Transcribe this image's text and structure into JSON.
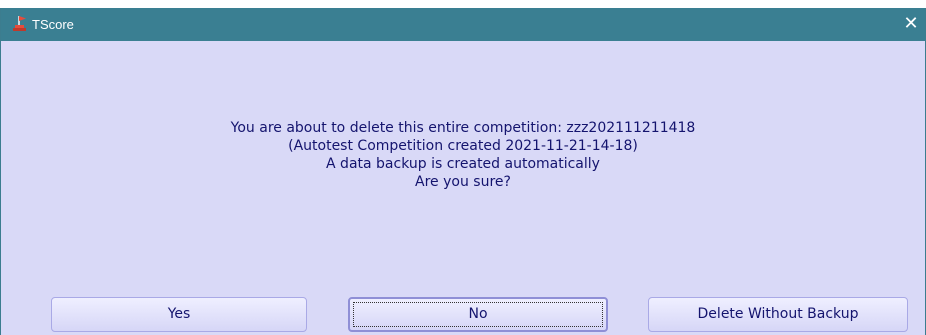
{
  "window": {
    "title": "TScore",
    "icons": {
      "app": "flag-icon",
      "close": "close-icon"
    },
    "close_glyph": "✕"
  },
  "message": {
    "line1": "You are about to delete this entire competition: zzz202111211418",
    "line2": "(Autotest Competition created 2021-11-21-14-18)",
    "line3": "A data backup is created automatically",
    "line4": "Are you sure?"
  },
  "buttons": {
    "yes": "Yes",
    "no": "No",
    "delete_without_backup": "Delete Without Backup"
  },
  "colors": {
    "titlebar": "#3a7f92",
    "dialog_background": "#d9d9f7",
    "text": "#14146e",
    "button_border": "#a9a9e6"
  }
}
